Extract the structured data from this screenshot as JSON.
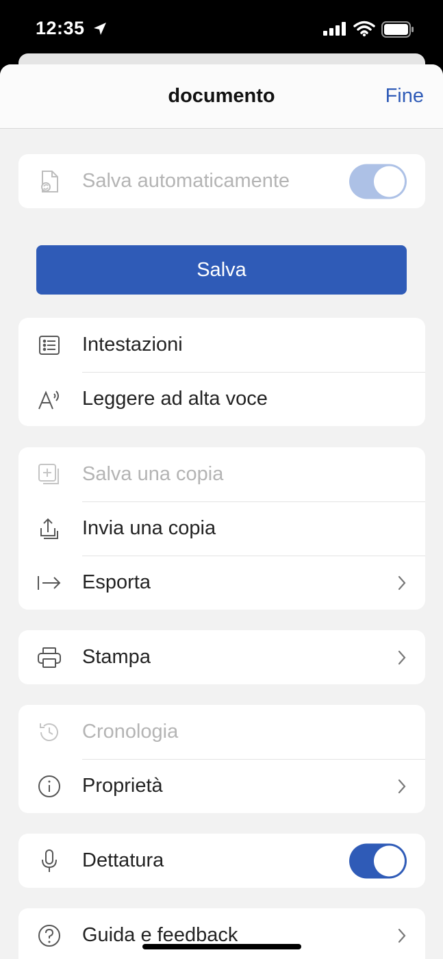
{
  "status_bar": {
    "time": "12:35"
  },
  "header": {
    "title": "documento",
    "done_label": "Fine"
  },
  "autosave": {
    "label": "Salva automaticamente",
    "enabled": true
  },
  "save_button": {
    "label": "Salva"
  },
  "group_view": [
    {
      "label": "Intestazioni",
      "icon": "list-icon"
    },
    {
      "label": "Leggere ad alta voce",
      "icon": "read-aloud-icon"
    }
  ],
  "group_share": [
    {
      "label": "Salva una copia",
      "icon": "save-copy-icon",
      "disabled": true
    },
    {
      "label": "Invia una copia",
      "icon": "share-icon"
    },
    {
      "label": "Esporta",
      "icon": "export-icon",
      "chevron": true
    }
  ],
  "group_print": [
    {
      "label": "Stampa",
      "icon": "printer-icon",
      "chevron": true
    }
  ],
  "group_info": [
    {
      "label": "Cronologia",
      "icon": "history-icon",
      "disabled": true
    },
    {
      "label": "Proprietà",
      "icon": "info-icon",
      "chevron": true
    }
  ],
  "dictation": {
    "label": "Dettatura",
    "enabled": true
  },
  "help": {
    "label": "Guida e feedback",
    "icon": "help-icon"
  },
  "colors": {
    "accent": "#2f5bb7",
    "background": "#f2f2f2"
  }
}
